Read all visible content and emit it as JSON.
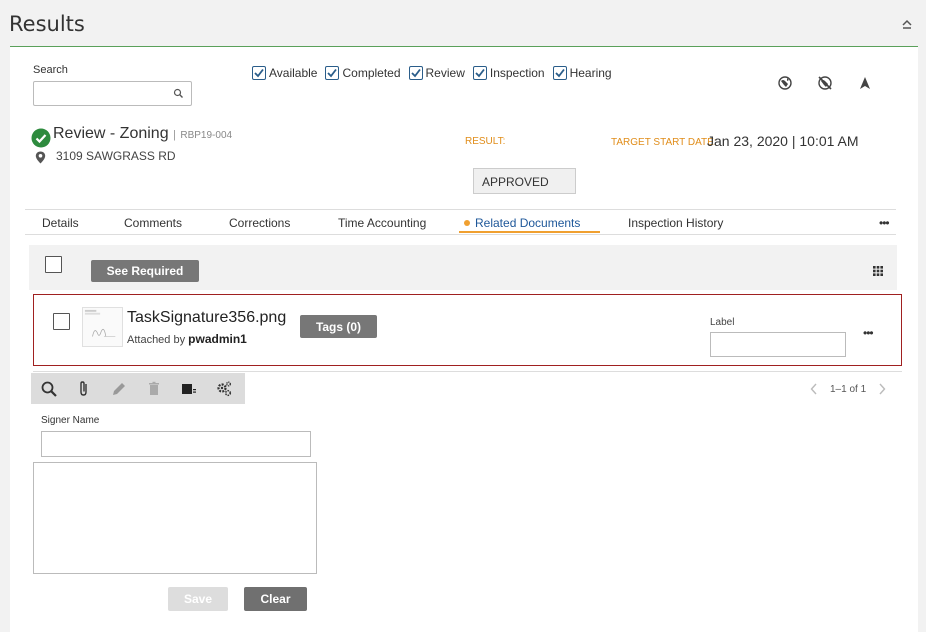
{
  "header": {
    "title": "Results"
  },
  "search": {
    "label": "Search",
    "value": "",
    "placeholder": ""
  },
  "filters": [
    {
      "label": "Available",
      "checked": true
    },
    {
      "label": "Completed",
      "checked": true
    },
    {
      "label": "Review",
      "checked": true
    },
    {
      "label": "Inspection",
      "checked": true
    },
    {
      "label": "Hearing",
      "checked": true
    }
  ],
  "map_icons": [
    "globe-icon",
    "globe-off-icon",
    "navigate-arrow-icon"
  ],
  "task": {
    "title": "Review - Zoning",
    "separator": "|",
    "id": "RBP19-004",
    "address": "3109 SAWGRASS RD",
    "status_icon": "check-circle-icon"
  },
  "result": {
    "label": "RESULT:",
    "value": "APPROVED"
  },
  "target_start": {
    "label": "TARGET START DATE:",
    "value": "Jan 23, 2020 | 10:01 AM"
  },
  "tabs": [
    {
      "label": "Details",
      "active": false
    },
    {
      "label": "Comments",
      "active": false
    },
    {
      "label": "Corrections",
      "active": false
    },
    {
      "label": "Time Accounting",
      "active": false
    },
    {
      "label": "Related Documents",
      "active": true
    },
    {
      "label": "Inspection History",
      "active": false
    }
  ],
  "tabs_more": "•••",
  "doc_toolbar": {
    "see_required_label": "See Required"
  },
  "document": {
    "name": "TaskSignature356.png",
    "attached_prefix": "Attached by",
    "attached_user": "pwadmin1",
    "tags_label": "Tags (0)",
    "label_field_label": "Label",
    "label_value": "",
    "more": "•••"
  },
  "actions": [
    "search-icon",
    "paperclip-icon",
    "pencil-icon",
    "trash-icon",
    "document-dropdown-icon",
    "settings-gears-icon"
  ],
  "pager": {
    "text": "1–1 of 1"
  },
  "signer": {
    "label": "Signer Name",
    "value": ""
  },
  "buttons": {
    "save_label": "Save",
    "clear_label": "Clear"
  },
  "colors": {
    "accent_green": "#5aa05a",
    "orange_label": "#e08d1a",
    "active_tab": "#1e5799",
    "selected_row_border": "#a02020",
    "checkbox_blue": "#2a5d8a"
  }
}
